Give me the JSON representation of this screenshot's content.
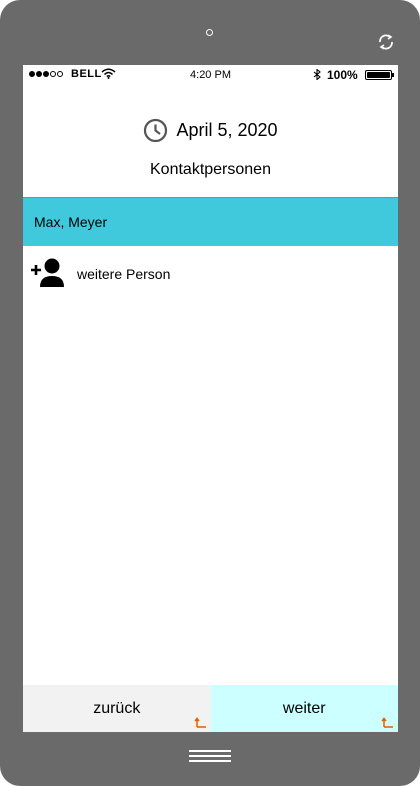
{
  "status_bar": {
    "carrier": "BELL",
    "time": "4:20 PM",
    "battery": "100%"
  },
  "header": {
    "date": "April 5, 2020",
    "title": "Kontaktpersonen"
  },
  "contacts": [
    {
      "name": "Max, Meyer"
    }
  ],
  "add_person": {
    "label": "weitere Person",
    "icon": "add-person-icon"
  },
  "footer": {
    "back_label": "zurück",
    "next_label": "weiter"
  },
  "colors": {
    "device_frame": "#6a6a6a",
    "selected_row": "#40c8dc",
    "back_button": "#f2f2f2",
    "next_button": "#ccffff",
    "corner_arrow": "#e06000"
  }
}
